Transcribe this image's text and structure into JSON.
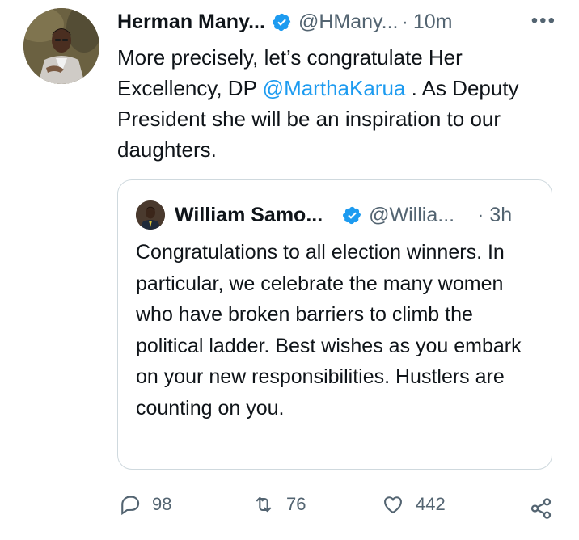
{
  "tweet": {
    "author_name": "Herman Many...",
    "author_handle": "@HMany...",
    "separator": "·",
    "time": "10m",
    "more_label": "•••",
    "text_before": "More precisely, let’s congratulate Her Excellency, DP ",
    "mention": "@MarthaKarua",
    "text_after": " . As Deputy President she will be an inspiration to our daughters."
  },
  "quoted": {
    "author_name": "William Samo...",
    "author_handle": "@Willia...",
    "separator": "·",
    "time": "3h",
    "text": "Congratulations to all election winners. In particular, we celebrate the many women who have broken barriers to climb the political ladder. Best wishes as you embark on your new responsibilities. Hustlers are counting on you."
  },
  "actions": {
    "replies": "98",
    "retweets": "76",
    "likes": "442"
  },
  "colors": {
    "accent": "#1d9bf0",
    "muted": "#536471",
    "text": "#0f1419",
    "border": "#cfd9de"
  },
  "icons": [
    "verified-badge-icon",
    "more-icon",
    "reply-icon",
    "retweet-icon",
    "like-icon",
    "share-icon"
  ]
}
